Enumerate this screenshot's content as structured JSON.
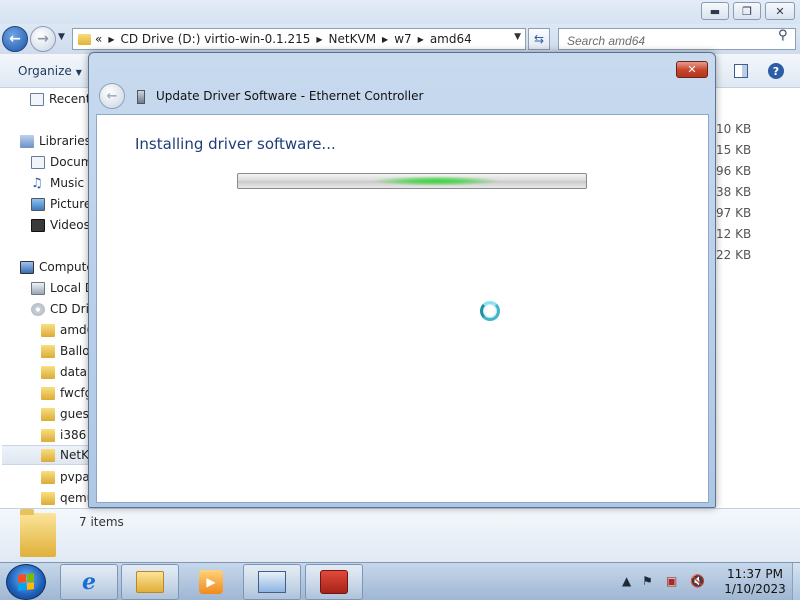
{
  "explorer": {
    "address": {
      "overflow": "«",
      "crumbs": [
        "CD Drive (D:) virtio-win-0.1.215",
        "NetKVM",
        "w7",
        "amd64"
      ]
    },
    "search_placeholder": "Search amd64",
    "organize_label": "Organize",
    "nav": {
      "recent": "Recent",
      "libraries": "Libraries",
      "documents": "Docum",
      "music": "Music",
      "pictures": "Picture",
      "videos": "Videos",
      "computer": "Compute",
      "local_disk": "Local D",
      "cd_drive": "CD Driv",
      "folders": [
        "amd6",
        "Ballo",
        "data",
        "fwcfg",
        "guest",
        "i386",
        "NetK",
        "pvpa",
        "qemu"
      ]
    },
    "sizes": [
      "10 KB",
      "15 KB",
      "96 KB",
      "38 KB",
      "97 KB",
      "12 KB",
      "22 KB"
    ],
    "items_count": "7 items"
  },
  "dialog": {
    "title": "Update Driver Software - Ethernet Controller",
    "heading": "Installing driver software...",
    "progress_state": "indeterminate",
    "progress_glow_fraction": 0.57
  },
  "taskbar": {
    "time": "11:37 PM",
    "date": "1/10/2023",
    "apps": [
      "internet-explorer",
      "windows-explorer",
      "windows-media-player",
      "device-manager",
      "setup"
    ]
  },
  "colors": {
    "dialog_heading": "#1d3f78",
    "progress_glow": "#3bd63b",
    "close_button": "#c8432b"
  }
}
